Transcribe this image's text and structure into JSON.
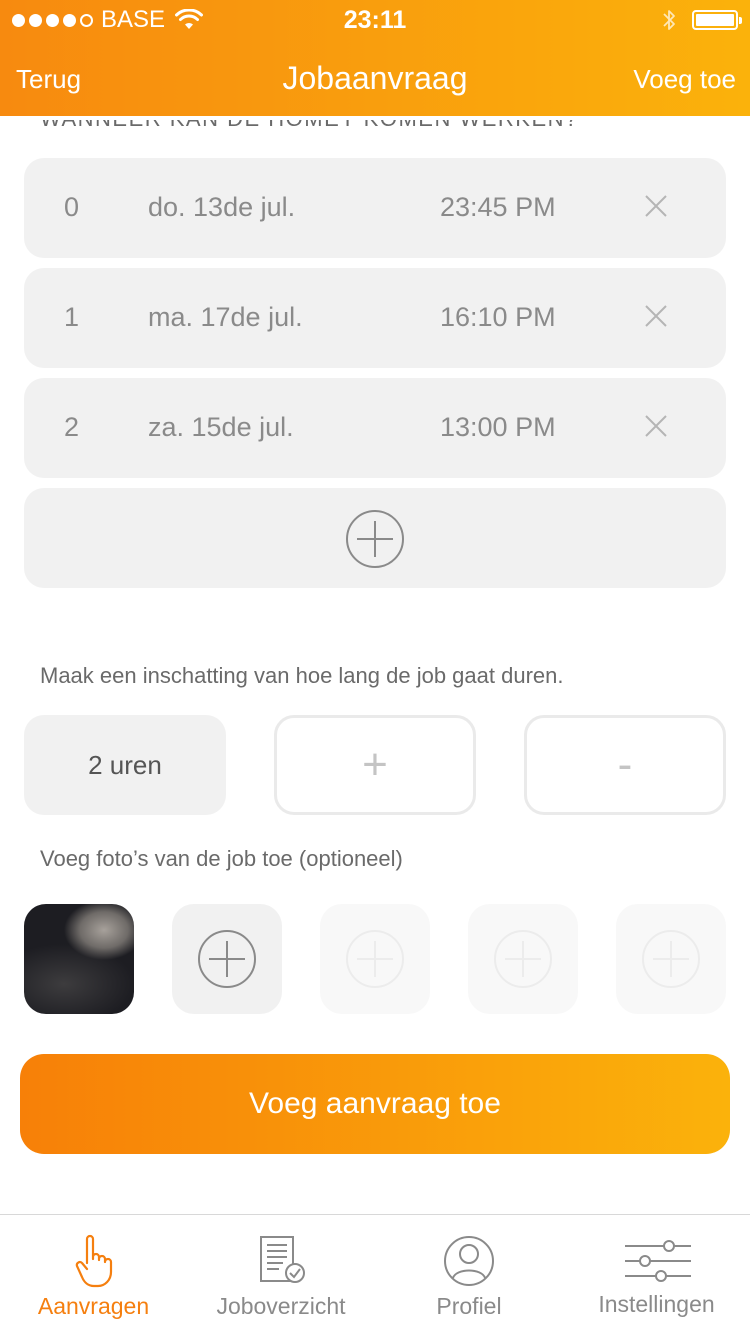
{
  "status_bar": {
    "carrier": "BASE",
    "time": "23:11"
  },
  "nav": {
    "back_label": "Terug",
    "title": "Jobaanvraag",
    "action_label": "Voeg toe"
  },
  "schedule": {
    "heading": "WANNEER KAN DE HOMEY KOMEN WERKEN?",
    "entries": [
      {
        "index": "0",
        "date": "do. 13de jul.",
        "time": "23:45 PM"
      },
      {
        "index": "1",
        "date": "ma. 17de jul.",
        "time": "16:10 PM"
      },
      {
        "index": "2",
        "date": "za. 15de jul.",
        "time": "13:00 PM"
      }
    ]
  },
  "duration": {
    "prompt": "Maak een inschatting van hoe lang de job gaat duren.",
    "value": "2 uren",
    "increment_label": "+",
    "decrement_label": "-"
  },
  "photos": {
    "prompt": "Voeg foto’s van de job toe (optioneel)"
  },
  "submit_label": "Voeg aanvraag toe",
  "tabs": [
    {
      "label": "Aanvragen",
      "icon": "hand-pointer-icon",
      "active": true
    },
    {
      "label": "Joboverzicht",
      "icon": "document-check-icon",
      "active": false
    },
    {
      "label": "Profiel",
      "icon": "user-circle-icon",
      "active": false
    },
    {
      "label": "Instellingen",
      "icon": "sliders-icon",
      "active": false
    }
  ],
  "colors": {
    "accent": "#f78a0f",
    "accent_end": "#fbb20b",
    "row_background": "#f1f1f1",
    "muted_text": "#8a8a8a"
  }
}
